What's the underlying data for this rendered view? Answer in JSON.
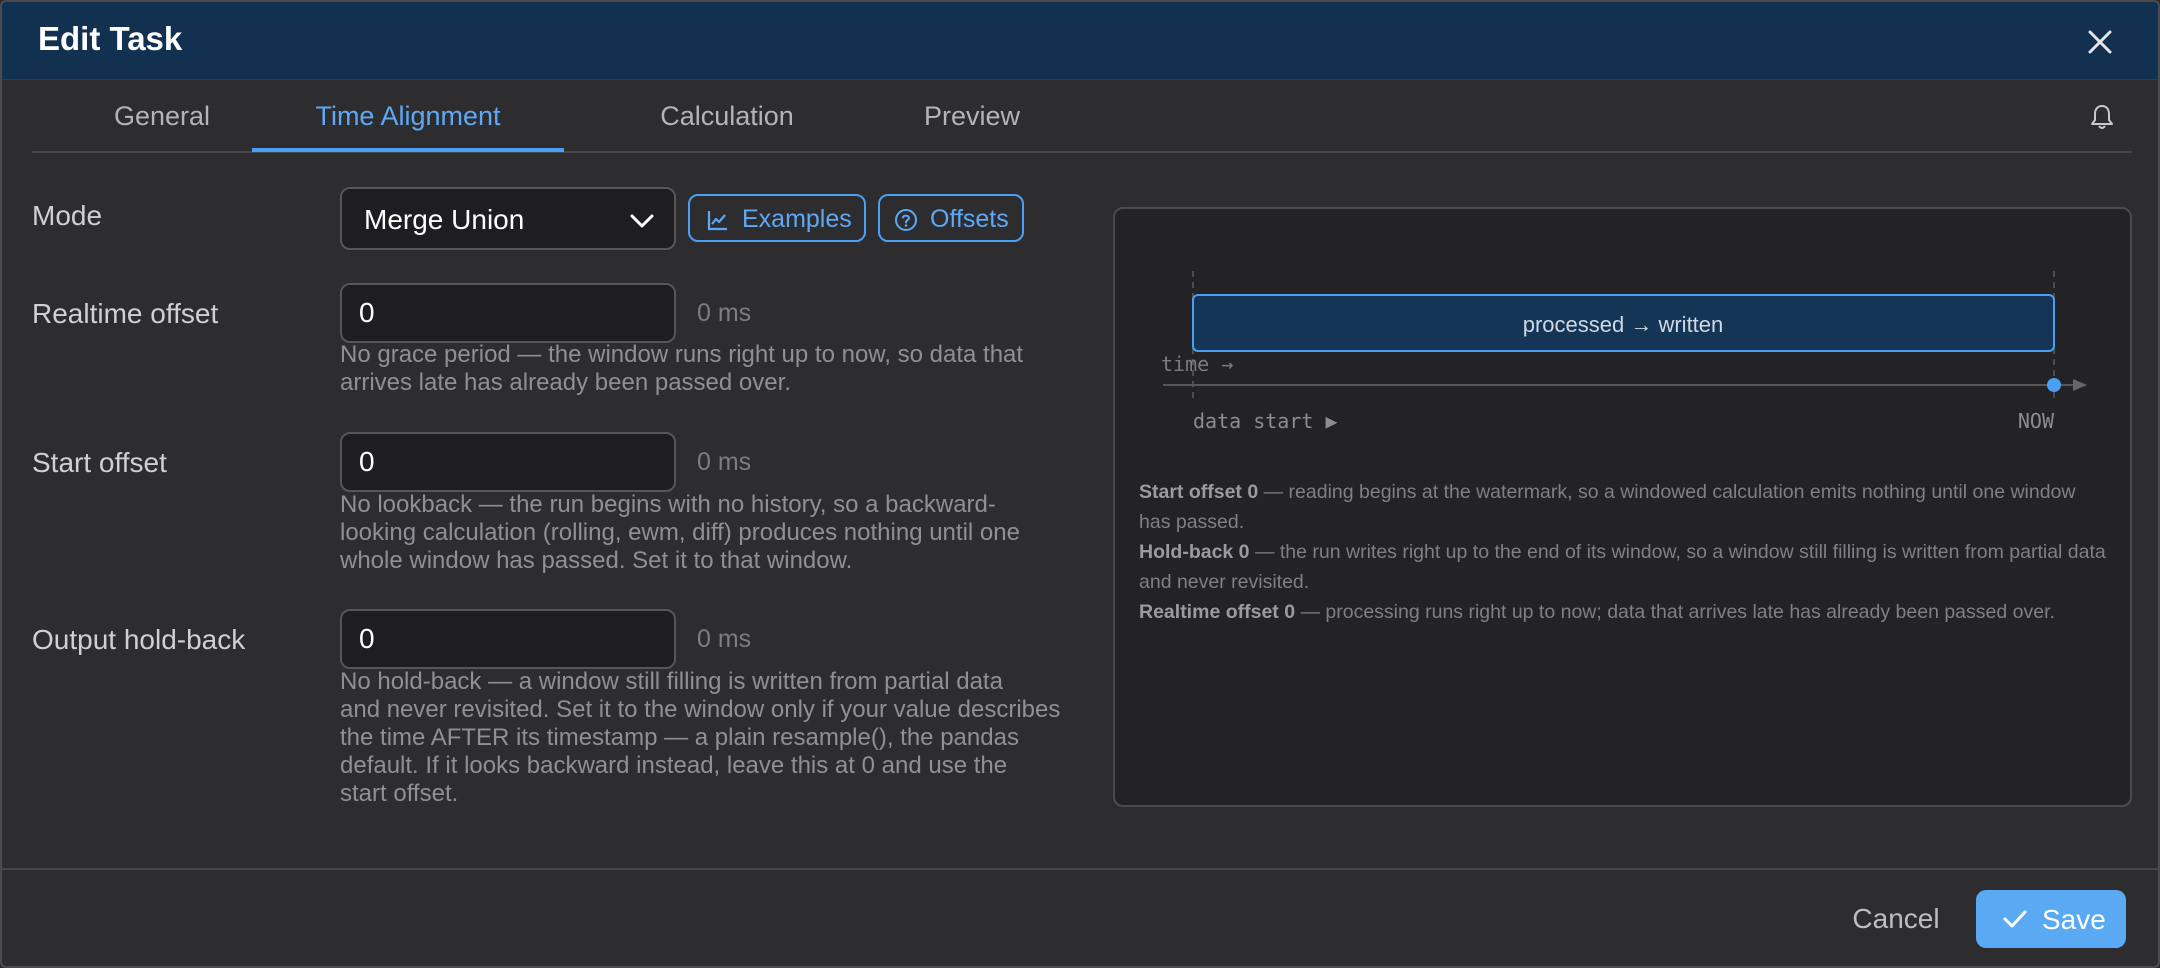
{
  "dialog": {
    "title": "Edit Task"
  },
  "tabs": [
    {
      "label": "General"
    },
    {
      "label": "Time Alignment"
    },
    {
      "label": "Calculation"
    },
    {
      "label": "Preview"
    }
  ],
  "active_tab": "Time Alignment",
  "mode": {
    "label": "Mode",
    "value": "Merge Union"
  },
  "buttons": {
    "examples": "Examples",
    "offsets": "Offsets"
  },
  "realtime_offset": {
    "label": "Realtime offset",
    "value": "0",
    "unit": "0 ms",
    "help_lines": [
      "No grace period — the window runs right up to now, so data that",
      "arrives late has already been passed over."
    ]
  },
  "start_offset": {
    "label": "Start offset",
    "value": "0",
    "unit": "0 ms",
    "help_lines": [
      "No lookback — the run begins with no history, so a backward-",
      "looking calculation (rolling, ewm, diff) produces nothing until one",
      "whole window has passed. Set it to that window."
    ]
  },
  "output_hold_back": {
    "label": "Output hold-back",
    "value": "0",
    "unit": "0 ms",
    "help_lines": [
      "No hold-back — a window still filling is written from partial data",
      "and never revisited. Set it to the window only if your value describes",
      "the time AFTER its timestamp — a plain resample(), the pandas",
      "default. If it looks backward instead, leave this at 0 and use the",
      "start offset."
    ]
  },
  "diagram": {
    "bar_label": "processed → written",
    "axis_label": "time →",
    "start_label": "data start ▶",
    "end_label": "NOW"
  },
  "notes": [
    {
      "key": "Start offset 0",
      "lines": [
        " — reading begins at the watermark, so a windowed calculation emits nothing until one window",
        "has passed."
      ]
    },
    {
      "key": "Hold-back 0",
      "lines": [
        " — the run writes right up to the end of its window, so a window still filling is written from partial data",
        "and never revisited."
      ]
    },
    {
      "key": "Realtime offset 0",
      "lines": [
        " — processing runs right up to now; data that arrives late has already been passed over."
      ]
    }
  ],
  "footer": {
    "cancel": "Cancel",
    "save": "Save"
  },
  "colors": {
    "accent": "#4a9ff2",
    "titlebar": "#12304f",
    "bar_fill": "#143556"
  },
  "icons": [
    "close-icon",
    "bell-icon",
    "chevron-down-icon",
    "chart-icon",
    "help-circle-icon",
    "check-icon"
  ]
}
